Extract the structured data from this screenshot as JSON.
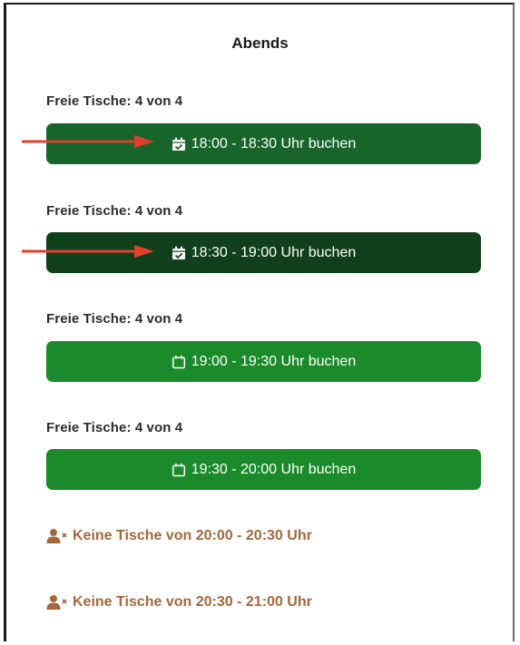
{
  "section": {
    "title": "Abends"
  },
  "slots": [
    {
      "available_label": "Freie Tische: 4 von 4",
      "button_label": "18:00 - 18:30 Uhr buchen",
      "icon": "calendar-check-icon",
      "color": "#17652a"
    },
    {
      "available_label": "Freie Tische: 4 von 4",
      "button_label": "18:30 - 19:00 Uhr buchen",
      "icon": "calendar-check-icon",
      "color": "#103f1c"
    },
    {
      "available_label": "Freie Tische: 4 von 4",
      "button_label": "19:00 - 19:30 Uhr buchen",
      "icon": "calendar-icon",
      "color": "#1b8a2a"
    },
    {
      "available_label": "Freie Tische: 4 von 4",
      "button_label": "19:30 - 20:00 Uhr buchen",
      "icon": "calendar-icon",
      "color": "#1b8a2a"
    }
  ],
  "unavailable": [
    {
      "label": "Keine Tische von 20:00 - 20:30 Uhr",
      "icon": "user-times-icon"
    },
    {
      "label": "Keine Tische von 20:30 - 21:00 Uhr",
      "icon": "user-times-icon"
    }
  ],
  "colors": {
    "annotation_arrow": "#e0402a",
    "unavailable_text": "#a4673a"
  }
}
